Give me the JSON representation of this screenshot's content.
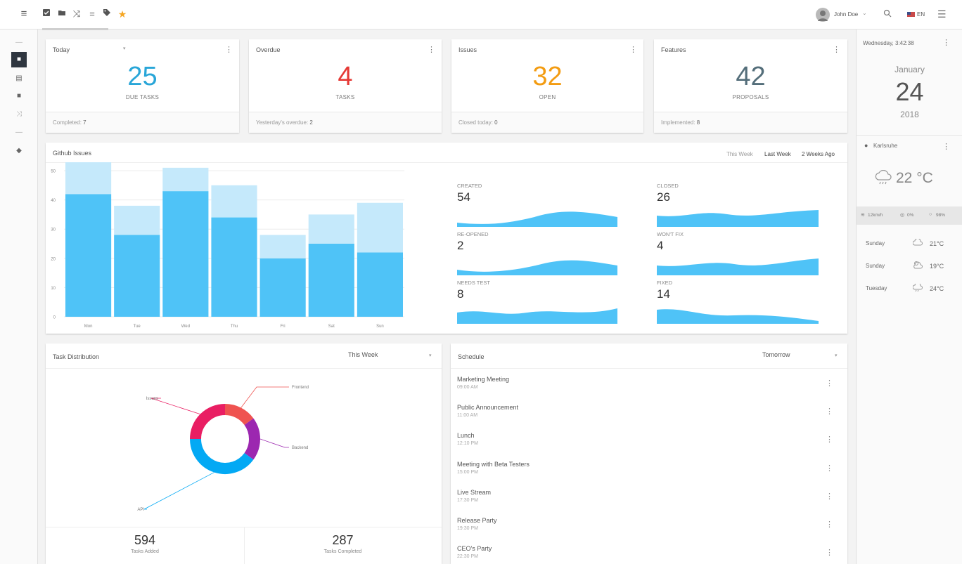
{
  "header": {
    "user_name": "John Doe",
    "language": "EN"
  },
  "toolbar_icons": [
    "menu-icon",
    "checkbox-icon",
    "folder-icon",
    "shuffle-icon",
    "equals-icon",
    "tag-icon",
    "star-icon"
  ],
  "summary_cards": [
    {
      "title": "Today",
      "value": "25",
      "label": "DUE TASKS",
      "footer_label": "Completed:",
      "footer_value": "7",
      "color": "#29a6d8"
    },
    {
      "title": "Overdue",
      "value": "4",
      "label": "TASKS",
      "footer_label": "Yesterday's overdue:",
      "footer_value": "2",
      "color": "#e53935"
    },
    {
      "title": "Issues",
      "value": "32",
      "label": "OPEN",
      "footer_label": "Closed today:",
      "footer_value": "0",
      "color": "#f39c12"
    },
    {
      "title": "Features",
      "value": "42",
      "label": "PROPOSALS",
      "footer_label": "Implemented:",
      "footer_value": "8",
      "color": "#546e7a"
    }
  ],
  "github": {
    "title": "Github Issues",
    "periods": [
      "This Week",
      "Last Week",
      "2 Weeks Ago"
    ],
    "stats": [
      {
        "label": "CREATED",
        "value": "54"
      },
      {
        "label": "CLOSED",
        "value": "26"
      },
      {
        "label": "RE-OPENED",
        "value": "2"
      },
      {
        "label": "WON'T FIX",
        "value": "4"
      },
      {
        "label": "NEEDS TEST",
        "value": "8"
      },
      {
        "label": "FIXED",
        "value": "14"
      }
    ]
  },
  "chart_data": {
    "type": "bar",
    "stacked": true,
    "categories": [
      "Mon",
      "Tue",
      "Wed",
      "Thu",
      "Fri",
      "Sat",
      "Sun"
    ],
    "series": [
      {
        "values": [
          42,
          28,
          43,
          34,
          20,
          25,
          22
        ],
        "color": "#4fc3f7"
      },
      {
        "values": [
          11,
          10,
          8,
          11,
          8,
          10,
          17
        ],
        "color": "#c5e9fb"
      }
    ],
    "ylim": [
      0,
      50
    ],
    "yticks": [
      "0",
      "10",
      "20",
      "30",
      "40",
      "50"
    ],
    "grid": true
  },
  "task_distribution": {
    "title": "Task Distribution",
    "period": "This Week",
    "segments": [
      {
        "label": "Frontend",
        "value": 15,
        "color": "#ef5350"
      },
      {
        "label": "Backend",
        "value": 20,
        "color": "#9c27b0"
      },
      {
        "label": "API",
        "value": 40,
        "color": "#03a9f4"
      },
      {
        "label": "Issues",
        "value": 25,
        "color": "#e91e63"
      }
    ],
    "added_value": "594",
    "added_label": "Tasks Added",
    "completed_value": "287",
    "completed_label": "Tasks Completed"
  },
  "schedule": {
    "title": "Schedule",
    "period": "Tomorrow",
    "items": [
      {
        "name": "Marketing Meeting",
        "time": "09:00 AM"
      },
      {
        "name": "Public Announcement",
        "time": "11:00 AM"
      },
      {
        "name": "Lunch",
        "time": "12:10 PM"
      },
      {
        "name": "Meeting with Beta Testers",
        "time": "15:00 PM"
      },
      {
        "name": "Live Stream",
        "time": "17:30 PM"
      },
      {
        "name": "Release Party",
        "time": "19:30 PM"
      },
      {
        "name": "CEO's Party",
        "time": "22:30 PM"
      }
    ]
  },
  "right_panel": {
    "datetime": "Wednesday, 3:42:38",
    "month": "January",
    "day": "24",
    "year": "2018",
    "location": "Karlsruhe",
    "temperature": "22 °C",
    "conditions": [
      {
        "icon": "wind-icon",
        "value": "12km/h"
      },
      {
        "icon": "humidity-icon",
        "value": "0%"
      },
      {
        "icon": "rain-icon",
        "value": "98%"
      }
    ],
    "forecast": [
      {
        "day": "Sunday",
        "temp": "21°C",
        "icon": "cloud-icon"
      },
      {
        "day": "Sunday",
        "temp": "19°C",
        "icon": "cloud-sun-icon"
      },
      {
        "day": "Tuesday",
        "temp": "24°C",
        "icon": "cloud-rain-icon"
      }
    ]
  }
}
